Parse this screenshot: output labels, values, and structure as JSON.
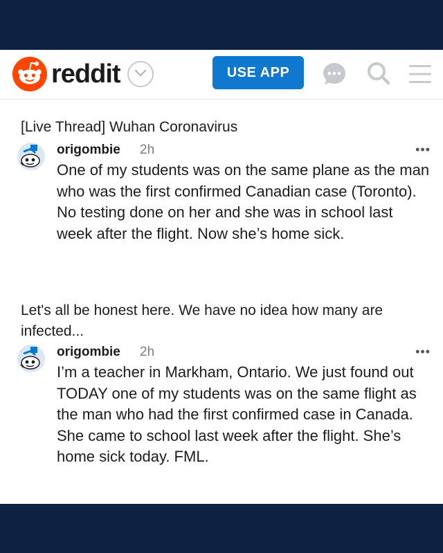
{
  "header": {
    "brand": "reddit",
    "use_app_label": "USE APP"
  },
  "threads": [
    {
      "title": "[Live Thread] Wuhan Coronavirus",
      "comment": {
        "username": "origombie",
        "time": "2h",
        "more": "•••",
        "body": "One of my students was on the same plane as the man who was the first confirmed Canadian case (Toronto). No testing done on her and she was in school last week after the flight. Now she’s home sick."
      }
    },
    {
      "title": "Let's all be honest here. We have no idea how many are infected...",
      "comment": {
        "username": "origombie",
        "time": "2h",
        "more": "•••",
        "body": "I’m a teacher in Markham, Ontario. We just found out TODAY one of my students was on the same flight as the man who had the first confirmed case in Canada. She came to school last week after the flight. She’s home sick today. FML."
      }
    }
  ],
  "colors": {
    "frame": "#0d2142",
    "brand_orange": "#ff4500",
    "button_blue": "#0f79d0",
    "icon_gray": "#c7c9cc"
  }
}
